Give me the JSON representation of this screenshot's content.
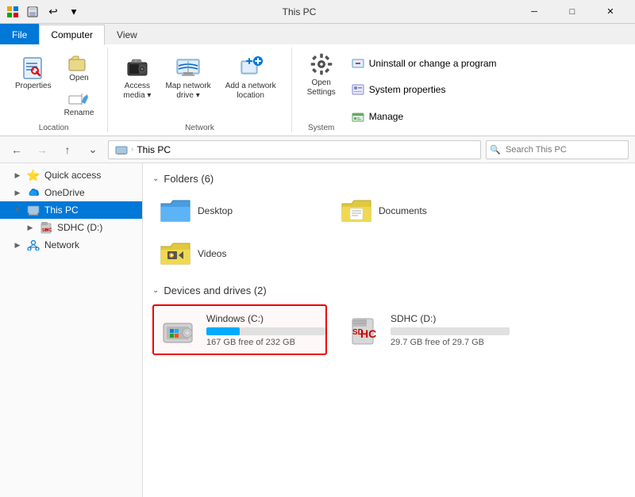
{
  "titlebar": {
    "title": "This PC",
    "qat": [
      "save",
      "undo",
      "customize"
    ],
    "controls": [
      "minimize",
      "maximize",
      "close"
    ]
  },
  "ribbon": {
    "tabs": [
      {
        "id": "file",
        "label": "File",
        "active": false
      },
      {
        "id": "computer",
        "label": "Computer",
        "active": true
      },
      {
        "id": "view",
        "label": "View",
        "active": false
      }
    ],
    "groups": {
      "location": {
        "label": "Location",
        "buttons": [
          {
            "id": "properties",
            "label": "Properties",
            "icon": "properties"
          },
          {
            "id": "open",
            "label": "Open",
            "icon": "open"
          },
          {
            "id": "rename",
            "label": "Rename",
            "icon": "rename"
          }
        ]
      },
      "network": {
        "label": "Network",
        "buttons": [
          {
            "id": "access-media",
            "label": "Access\nmedia ▾",
            "icon": "access-media"
          },
          {
            "id": "map-drive",
            "label": "Map network\ndrive ▾",
            "icon": "map-drive"
          },
          {
            "id": "add-location",
            "label": "Add a network\nlocation",
            "icon": "add-location"
          }
        ]
      },
      "system": {
        "label": "System",
        "buttons": [
          {
            "id": "open-settings",
            "label": "Open\nSettings",
            "icon": "settings"
          }
        ],
        "right_items": [
          {
            "id": "uninstall",
            "label": "Uninstall or change a program",
            "icon": "uninstall"
          },
          {
            "id": "system-properties",
            "label": "System properties",
            "icon": "system"
          },
          {
            "id": "manage",
            "label": "Manage",
            "icon": "manage"
          }
        ]
      }
    }
  },
  "addressbar": {
    "back_disabled": false,
    "forward_disabled": true,
    "up_disabled": false,
    "path": [
      "This PC"
    ],
    "search_placeholder": "Search This PC"
  },
  "sidebar": {
    "items": [
      {
        "id": "quick-access",
        "label": "Quick access",
        "icon": "⭐",
        "expanded": false,
        "indent": 0
      },
      {
        "id": "onedrive",
        "label": "OneDrive",
        "icon": "☁",
        "expanded": false,
        "indent": 0
      },
      {
        "id": "this-pc",
        "label": "This PC",
        "icon": "💻",
        "expanded": true,
        "selected": true,
        "indent": 0
      },
      {
        "id": "sdhc",
        "label": "SDHC (D:)",
        "icon": "💾",
        "expanded": false,
        "indent": 1
      },
      {
        "id": "network",
        "label": "Network",
        "icon": "🌐",
        "expanded": false,
        "indent": 0
      }
    ]
  },
  "content": {
    "folders_section": {
      "label": "Folders (6)",
      "folders": [
        {
          "id": "desktop",
          "label": "Desktop"
        },
        {
          "id": "documents",
          "label": "Documents"
        },
        {
          "id": "videos",
          "label": "Videos"
        }
      ]
    },
    "drives_section": {
      "label": "Devices and drives (2)",
      "drives": [
        {
          "id": "windows-c",
          "label": "Windows (C:)",
          "free": "167 GB free of 232 GB",
          "progress": 28,
          "selected": true,
          "type": "windows"
        },
        {
          "id": "sdhc-d",
          "label": "SDHC (D:)",
          "free": "29.7 GB free of 29.7 GB",
          "progress": 0,
          "selected": false,
          "type": "sdhc"
        }
      ]
    }
  }
}
